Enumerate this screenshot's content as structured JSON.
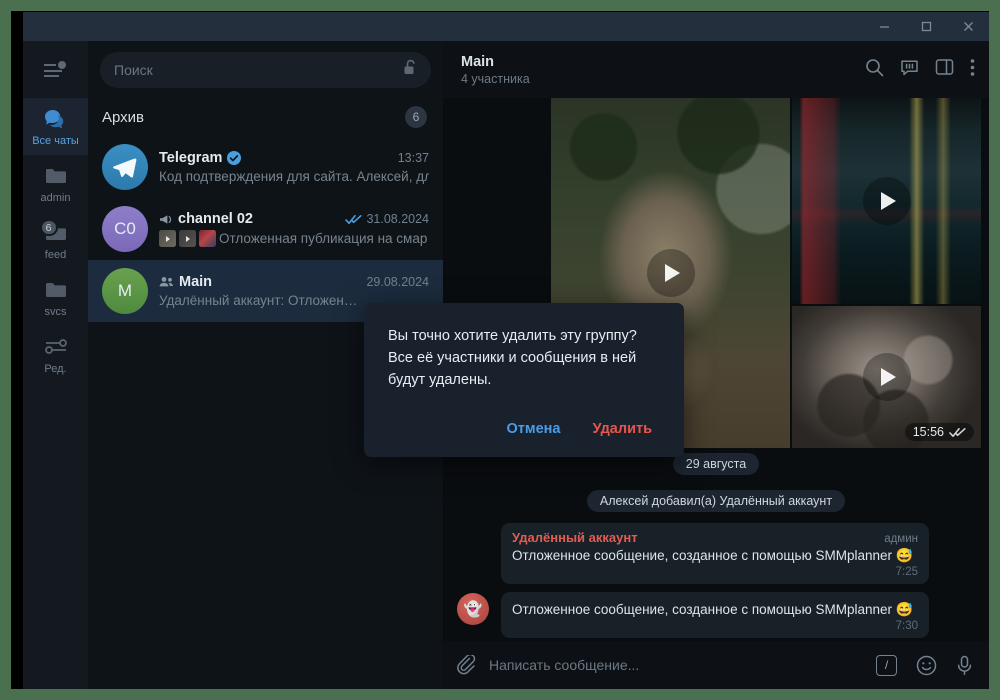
{
  "window": {
    "minimize_label": "Свернуть",
    "maximize_label": "Развернуть",
    "close_label": "Закрыть"
  },
  "rail": {
    "menu_icon": "hamburger-menu-icon",
    "items": [
      {
        "label": "Все чаты",
        "icon": "chats-icon",
        "active": true,
        "badge": ""
      },
      {
        "label": "admin",
        "icon": "folder-icon",
        "active": false,
        "badge": ""
      },
      {
        "label": "feed",
        "icon": "folder-icon",
        "active": false,
        "badge": "6"
      },
      {
        "label": "svcs",
        "icon": "folder-icon",
        "active": false,
        "badge": ""
      },
      {
        "label": "Ред.",
        "icon": "sliders-icon",
        "active": false,
        "badge": ""
      }
    ]
  },
  "search": {
    "placeholder": "Поиск",
    "lock_icon": "unlocked-padlock-icon"
  },
  "archive": {
    "title": "Архив",
    "badge": "6"
  },
  "chats": [
    {
      "avatar_text": "",
      "avatar_kind": "telegram-logo",
      "name": "Telegram",
      "verified": true,
      "time": "13:37",
      "preview": "Код подтверждения для сайта. Алексей, для…",
      "read_marks": false,
      "prefix_icon": "",
      "thumbs": 0,
      "selected": false
    },
    {
      "avatar_text": "C0",
      "avatar_kind": "initials-purple",
      "name": "channel 02",
      "verified": false,
      "time": "31.08.2024",
      "preview": "Отложенная публикация на смар…",
      "read_marks": true,
      "prefix_icon": "megaphone-icon",
      "thumbs": 3,
      "selected": false
    },
    {
      "avatar_text": "M",
      "avatar_kind": "initials-green",
      "name": "Main",
      "verified": false,
      "time": "29.08.2024",
      "preview": "Удалённый аккаунт: Отложен…",
      "read_marks": false,
      "prefix_icon": "group-icon",
      "thumbs": 0,
      "selected": true
    }
  ],
  "conversation": {
    "title": "Main",
    "subtitle": "4 участника",
    "actions": [
      {
        "name": "search-icon",
        "label": "Поиск"
      },
      {
        "name": "comments-icon",
        "label": "Обсуждение"
      },
      {
        "name": "panel-toggle-icon",
        "label": "Панель"
      },
      {
        "name": "more-options-icon",
        "label": "Ещё"
      }
    ],
    "album": {
      "tiles": [
        {
          "scene": "deer-in-forest",
          "has_play": true,
          "time": ""
        },
        {
          "scene": "night-street",
          "has_play": true,
          "time": ""
        },
        {
          "scene": "smoke-wreckage",
          "has_play": true,
          "time": "15:56"
        }
      ],
      "status_checks": "read-double-check-icon"
    },
    "date_divider": "29 августа",
    "service_message": "Алексей добавил(а) Удалённый аккаунт",
    "messages": [
      {
        "author": "Удалённый аккаунт",
        "role": "админ",
        "text": "Отложенное сообщение, созданное с помощью SMMplanner",
        "emoji": "😅",
        "time": "7:25",
        "has_avatar": false
      },
      {
        "author": "",
        "role": "",
        "text": "Отложенное сообщение, созданное с помощью SMMplanner",
        "emoji": "😅",
        "time": "7:30",
        "has_avatar": true,
        "avatar_emoji": "👻"
      }
    ]
  },
  "composer": {
    "attach_icon": "paperclip-icon",
    "placeholder": "Написать сообщение...",
    "command_label": "/",
    "emoji_icon": "smiley-icon",
    "mic_icon": "microphone-icon"
  },
  "modal": {
    "line1": "Вы точно хотите удалить эту группу?",
    "line2": "Все её участники и сообщения в ней",
    "line3": "будут удалены.",
    "cancel_label": "Отмена",
    "delete_label": "Удалить"
  },
  "colors": {
    "accent_blue": "#4a9be8",
    "danger_red": "#e8554e",
    "selected_row": "#1c2c3e",
    "titlebar": "#242f3d",
    "outer_border": "#4a7050"
  }
}
